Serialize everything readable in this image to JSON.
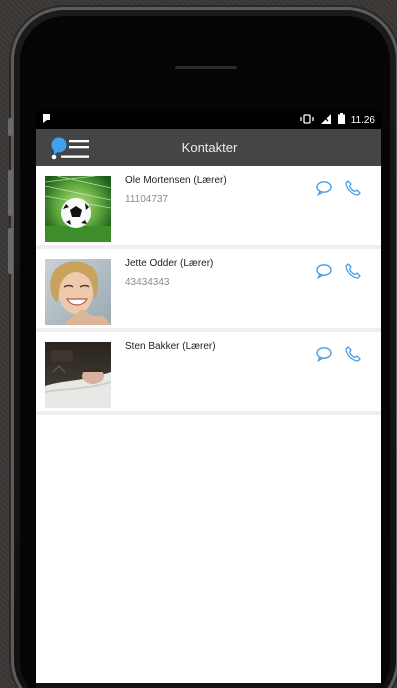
{
  "status_bar": {
    "time": "11.26"
  },
  "app_bar": {
    "title": "Kontakter",
    "menu_icon": "profile-menu-icon"
  },
  "contacts": [
    {
      "name": "Ole Mortensen (Lærer)",
      "phone": "11104737",
      "avatar": "soccer-ball-photo"
    },
    {
      "name": "Jette Odder (Lærer)",
      "phone": "43434343",
      "avatar": "woman-portrait-photo"
    },
    {
      "name": "Sten Bakker (Lærer)",
      "phone": "",
      "avatar": "man-sleeping-photo"
    }
  ],
  "colors": {
    "accent": "#4aa0e8",
    "app_bar": "#454545",
    "status_bar": "#000000"
  }
}
